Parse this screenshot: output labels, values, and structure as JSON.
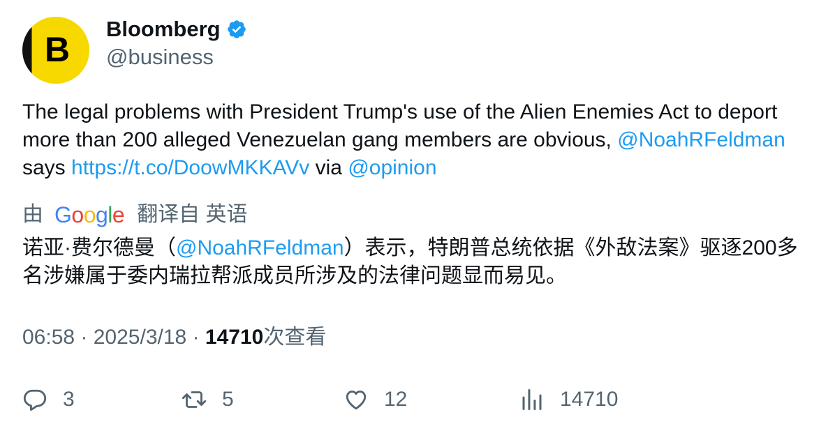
{
  "author": {
    "avatar_letter": "B",
    "name": "Bloomberg",
    "handle": "@business",
    "verified": true
  },
  "tweet": {
    "text_part1": "The legal problems with President Trump's use of the Alien Enemies Act to deport more than 200 alleged Venezuelan gang members are obvious, ",
    "mention1": "@NoahRFeldman",
    "text_part2": " says ",
    "url": "https://t.co/DoowMKKAVv",
    "text_part3": " via ",
    "mention2": "@opinion"
  },
  "translation": {
    "by_label": "由",
    "provider": "Google",
    "from_label": "翻译自 英语",
    "text_part1": "诺亚·费尔德曼（",
    "mention": "@NoahRFeldman",
    "text_part2": "）表示，特朗普总统依据《外敌法案》驱逐200多名涉嫌属于委内瑞拉帮派成员所涉及的法律问题显而易见。"
  },
  "meta": {
    "time": "06:58",
    "sep1": " · ",
    "date": "2025/3/18",
    "sep2": " · ",
    "views": "14710",
    "views_label": "次查看"
  },
  "actions": {
    "replies": "3",
    "retweets": "5",
    "likes": "12",
    "views": "14710"
  },
  "colors": {
    "link": "#1d9bf0",
    "secondary": "#536471",
    "brand_yellow": "#f7d900"
  }
}
